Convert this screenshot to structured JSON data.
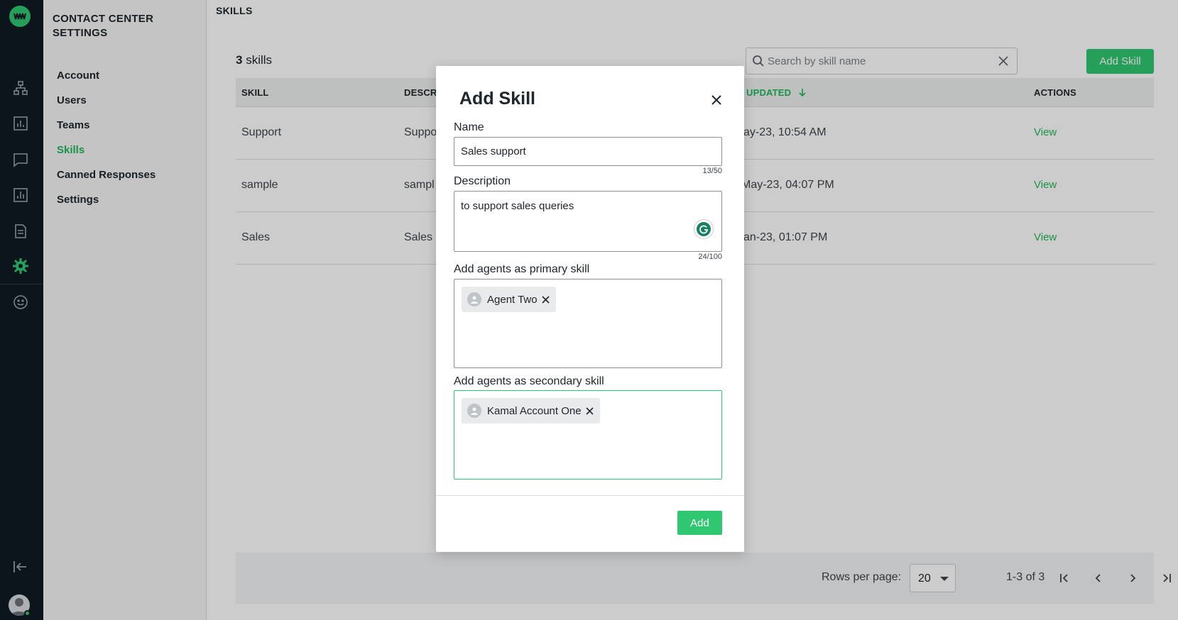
{
  "rail": {
    "icons": [
      "logo-icon",
      "org-chart-icon",
      "analytics-icon",
      "chat-icon",
      "reports-icon",
      "document-icon",
      "settings-icon",
      "emoji-icon",
      "logout-icon",
      "user-avatar-icon"
    ],
    "accent": "#2fc770",
    "background": "#0f1b22"
  },
  "settings_nav": {
    "title": "CONTACT CENTER SETTINGS",
    "items": [
      {
        "label": "Account",
        "active": false
      },
      {
        "label": "Users",
        "active": false
      },
      {
        "label": "Teams",
        "active": false
      },
      {
        "label": "Skills",
        "active": true
      },
      {
        "label": "Canned Responses",
        "active": false
      },
      {
        "label": "Settings",
        "active": false
      }
    ]
  },
  "main": {
    "breadcrumb": "SKILLS",
    "count_number": "3",
    "count_label": "skills",
    "search": {
      "placeholder": "Search by skill name"
    },
    "add_skill_label": "Add Skill",
    "table": {
      "headers": {
        "skill": "SKILL",
        "description": "DESCRI",
        "updated": "UPDATED",
        "actions": "ACTIONS"
      },
      "rows": [
        {
          "skill": "Support",
          "description": "Suppo",
          "updated": "ay-23, 10:54 AM",
          "action": "View"
        },
        {
          "skill": "sample",
          "description": "sampl",
          "updated": "May-23, 04:07 PM",
          "action": "View"
        },
        {
          "skill": "Sales",
          "description": "Sales",
          "updated": "an-23, 01:07 PM",
          "action": "View"
        }
      ]
    },
    "pager": {
      "rows_per_page_label": "Rows per page:",
      "rows_per_page_value": "20",
      "range": "1-3 of 3"
    }
  },
  "modal": {
    "title": "Add Skill",
    "name_label": "Name",
    "name_value": "Sales support",
    "name_counter": "13/50",
    "description_label": "Description",
    "description_value": "to support sales queries",
    "description_counter": "24/100",
    "primary_label": "Add agents as primary skill",
    "primary_agents": [
      "Agent Two"
    ],
    "secondary_label": "Add agents as secondary skill",
    "secondary_agents": [
      "Kamal Account One"
    ],
    "add_label": "Add"
  }
}
